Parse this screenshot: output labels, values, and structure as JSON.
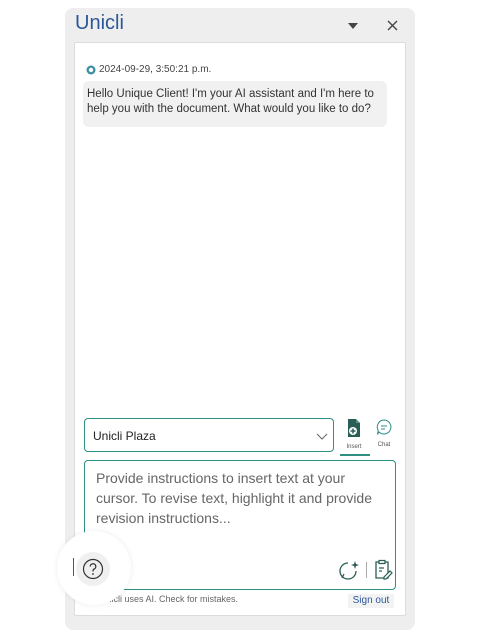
{
  "pane": {
    "title": "Unicli",
    "menu_icon": "chevron-down-icon",
    "close_icon": "close-icon"
  },
  "conversation": {
    "timestamp": "2024-09-29, 3:50:21 p.m.",
    "message": "Hello Unique Client! I'm your AI assistant and I'm here to help you with the document. What would you like to do?"
  },
  "controls": {
    "selected_option": "Unicli Plaza",
    "insert_label": "Insert",
    "chat_label": "Chat",
    "active_mode": "Insert"
  },
  "prompt": {
    "placeholder": "Provide instructions to insert text at your cursor. To revise text, highlight it and provide revision instructions..."
  },
  "footer": {
    "disclaimer": "Unicli uses AI. Check for mistakes.",
    "signout_label": "Sign out"
  },
  "colors": {
    "accent": "#2f8f82",
    "title": "#2b579a"
  }
}
